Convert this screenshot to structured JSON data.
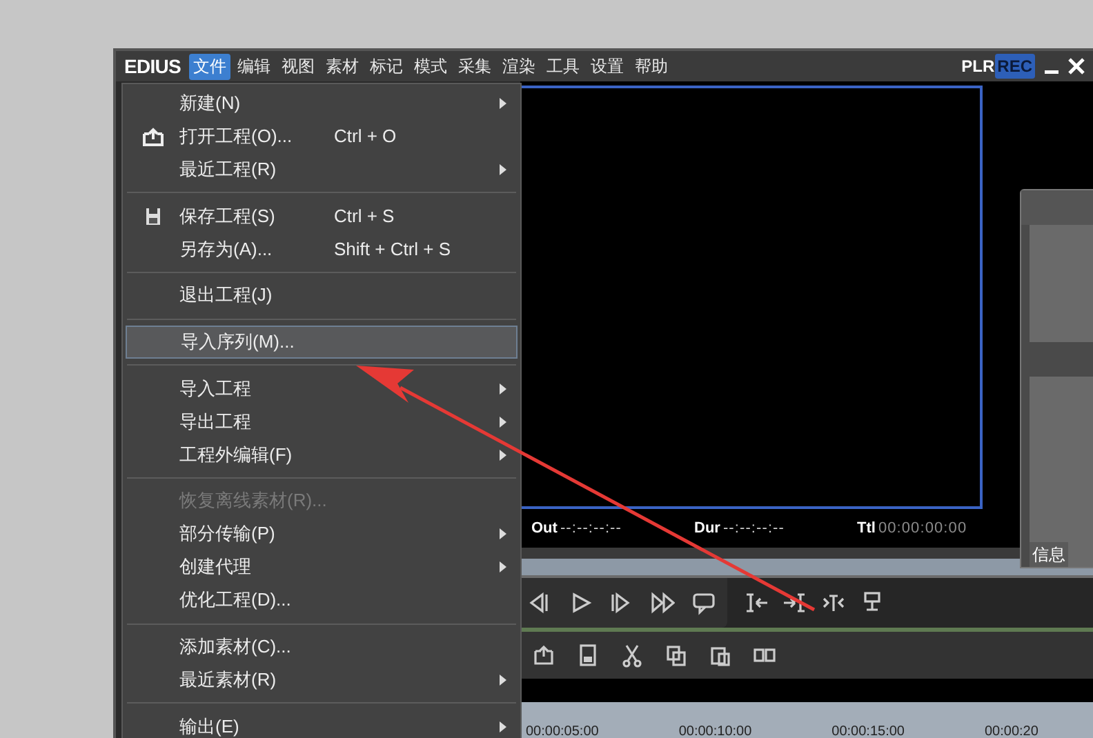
{
  "window": {
    "app_name": "EDIUS",
    "menubar": [
      {
        "label": "文件",
        "selected": true
      },
      {
        "label": "编辑",
        "selected": false
      },
      {
        "label": "视图",
        "selected": false
      },
      {
        "label": "素材",
        "selected": false
      },
      {
        "label": "标记",
        "selected": false
      },
      {
        "label": "模式",
        "selected": false
      },
      {
        "label": "采集",
        "selected": false
      },
      {
        "label": "渲染",
        "selected": false
      },
      {
        "label": "工具",
        "selected": false
      },
      {
        "label": "设置",
        "selected": false
      },
      {
        "label": "帮助",
        "selected": false
      }
    ],
    "mode_labels": [
      "PLR",
      "REC"
    ]
  },
  "file_menu": [
    {
      "kind": "item",
      "label": "新建(N)",
      "submenu": true,
      "selected": false,
      "disabled": false
    },
    {
      "kind": "open",
      "label": "打开工程(O)...",
      "shortcut": "Ctrl + O",
      "selected": false,
      "disabled": false
    },
    {
      "kind": "item",
      "label": "最近工程(R)",
      "submenu": true,
      "selected": false,
      "disabled": false
    },
    {
      "kind": "separator"
    },
    {
      "kind": "save",
      "label": "保存工程(S)",
      "shortcut": "Ctrl + S",
      "selected": false,
      "disabled": false
    },
    {
      "kind": "item",
      "label": "另存为(A)...",
      "shortcut": "Shift + Ctrl + S",
      "selected": false,
      "disabled": false
    },
    {
      "kind": "separator"
    },
    {
      "kind": "item",
      "label": "退出工程(J)",
      "selected": false,
      "disabled": false
    },
    {
      "kind": "separator"
    },
    {
      "kind": "item",
      "label": "导入序列(M)...",
      "selected": true,
      "disabled": false
    },
    {
      "kind": "separator"
    },
    {
      "kind": "item",
      "label": "导入工程",
      "submenu": true,
      "selected": false,
      "disabled": false
    },
    {
      "kind": "item",
      "label": "导出工程",
      "submenu": true,
      "selected": false,
      "disabled": false
    },
    {
      "kind": "item",
      "label": "工程外编辑(F)",
      "submenu": true,
      "selected": false,
      "disabled": false
    },
    {
      "kind": "separator"
    },
    {
      "kind": "item",
      "label": "恢复离线素材(R)...",
      "selected": false,
      "disabled": true
    },
    {
      "kind": "item",
      "label": "部分传输(P)",
      "submenu": true,
      "selected": false,
      "disabled": false
    },
    {
      "kind": "item",
      "label": "创建代理",
      "submenu": true,
      "selected": false,
      "disabled": false
    },
    {
      "kind": "item",
      "label": "优化工程(D)...",
      "selected": false,
      "disabled": false
    },
    {
      "kind": "separator"
    },
    {
      "kind": "item",
      "label": "添加素材(C)...",
      "selected": false,
      "disabled": false
    },
    {
      "kind": "item",
      "label": "最近素材(R)",
      "submenu": true,
      "selected": false,
      "disabled": false
    },
    {
      "kind": "separator"
    },
    {
      "kind": "item",
      "label": "输出(E)",
      "submenu": true,
      "selected": false,
      "disabled": false
    }
  ],
  "timecodes": [
    {
      "label": "Out",
      "value": "--:--:--:--"
    },
    {
      "label": "Dur",
      "value": "--:--:--:--"
    },
    {
      "label": "Ttl",
      "value": "00:00:00:00"
    }
  ],
  "info_panel": {
    "tab": "信息"
  },
  "timeline_ruler": [
    "00:00:05:00",
    "00:00:10:00",
    "00:00:15:00",
    "00:00:20"
  ]
}
